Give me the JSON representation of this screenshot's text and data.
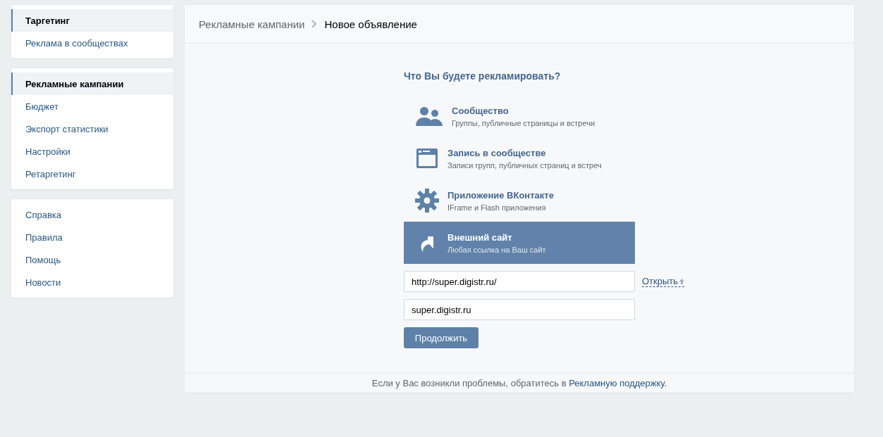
{
  "sidebar": {
    "groups": [
      {
        "items": [
          {
            "label": "Таргетинг",
            "selected": true
          },
          {
            "label": "Реклама в сообществах",
            "selected": false
          }
        ]
      },
      {
        "items": [
          {
            "label": "Рекламные кампании",
            "selected": true
          },
          {
            "label": "Бюджет",
            "selected": false
          },
          {
            "label": "Экспорт статистики",
            "selected": false
          },
          {
            "label": "Настройки",
            "selected": false
          },
          {
            "label": "Ретаргетинг",
            "selected": false
          }
        ]
      },
      {
        "items": [
          {
            "label": "Справка",
            "selected": false
          },
          {
            "label": "Правила",
            "selected": false
          },
          {
            "label": "Помощь",
            "selected": false
          },
          {
            "label": "Новости",
            "selected": false
          }
        ]
      }
    ]
  },
  "breadcrumb": {
    "parent": "Рекламные кампании",
    "current": "Новое объявление"
  },
  "question": "Что Вы будете рекламировать?",
  "options": [
    {
      "kind": "community",
      "title": "Сообщество",
      "subtitle": "Группы, публичные страницы и встречи",
      "selected": false
    },
    {
      "kind": "post",
      "title": "Запись в сообществе",
      "subtitle": "Записи групп, публичных страниц и встреч",
      "selected": false
    },
    {
      "kind": "app",
      "title": "Приложение ВКонтакте",
      "subtitle": "IFrame и Flash приложения",
      "selected": false
    },
    {
      "kind": "site",
      "title": "Внешний сайт",
      "subtitle": "Любая ссылка на Ваш сайт",
      "selected": true
    }
  ],
  "url_field": {
    "value": "http://super.digistr.ru/"
  },
  "open_link": "Открыть",
  "domain_field": {
    "value": "super.digistr.ru"
  },
  "continue_button": "Продолжить",
  "footer": {
    "before": "Если у Вас возникли проблемы, обратитесь в ",
    "link": "Рекламную поддержку",
    "after": "."
  }
}
